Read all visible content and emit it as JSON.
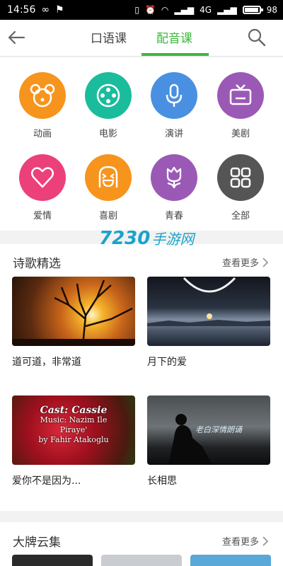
{
  "status": {
    "time": "14:56",
    "battery": "98",
    "signal1": "4G",
    "signal2": "4G"
  },
  "header": {
    "tabs": [
      {
        "label": "口语课"
      },
      {
        "label": "配音课"
      }
    ]
  },
  "categories": [
    {
      "label": "动画",
      "icon": "bear-icon",
      "color": "#f7941d"
    },
    {
      "label": "电影",
      "icon": "film-reel-icon",
      "color": "#1bbc9b"
    },
    {
      "label": "演讲",
      "icon": "microphone-icon",
      "color": "#4a90e2"
    },
    {
      "label": "美剧",
      "icon": "tv-icon",
      "color": "#9b59b6"
    },
    {
      "label": "爱情",
      "icon": "heart-icon",
      "color": "#ec407a"
    },
    {
      "label": "喜剧",
      "icon": "laughing-face-icon",
      "color": "#f7941d"
    },
    {
      "label": "青春",
      "icon": "tulip-icon",
      "color": "#9b59b6"
    },
    {
      "label": "全部",
      "icon": "grid-icon",
      "color": "#555555"
    }
  ],
  "watermark": {
    "number": "7230",
    "text": "手游网"
  },
  "poetry": {
    "title": "诗歌精选",
    "more": "查看更多",
    "cards": [
      {
        "title": "道可道，非常道"
      },
      {
        "title": "月下的爱"
      },
      {
        "title": "爱你不是因为...",
        "overlay": [
          "Cast: Cassie",
          "Music: Nazim Ile",
          "Piraye'",
          "by Fahir Atakoglu"
        ]
      },
      {
        "title": "长相思",
        "overlay": [
          "老白深情朗诵"
        ]
      }
    ]
  },
  "bigname": {
    "title": "大牌云集",
    "more": "查看更多"
  }
}
